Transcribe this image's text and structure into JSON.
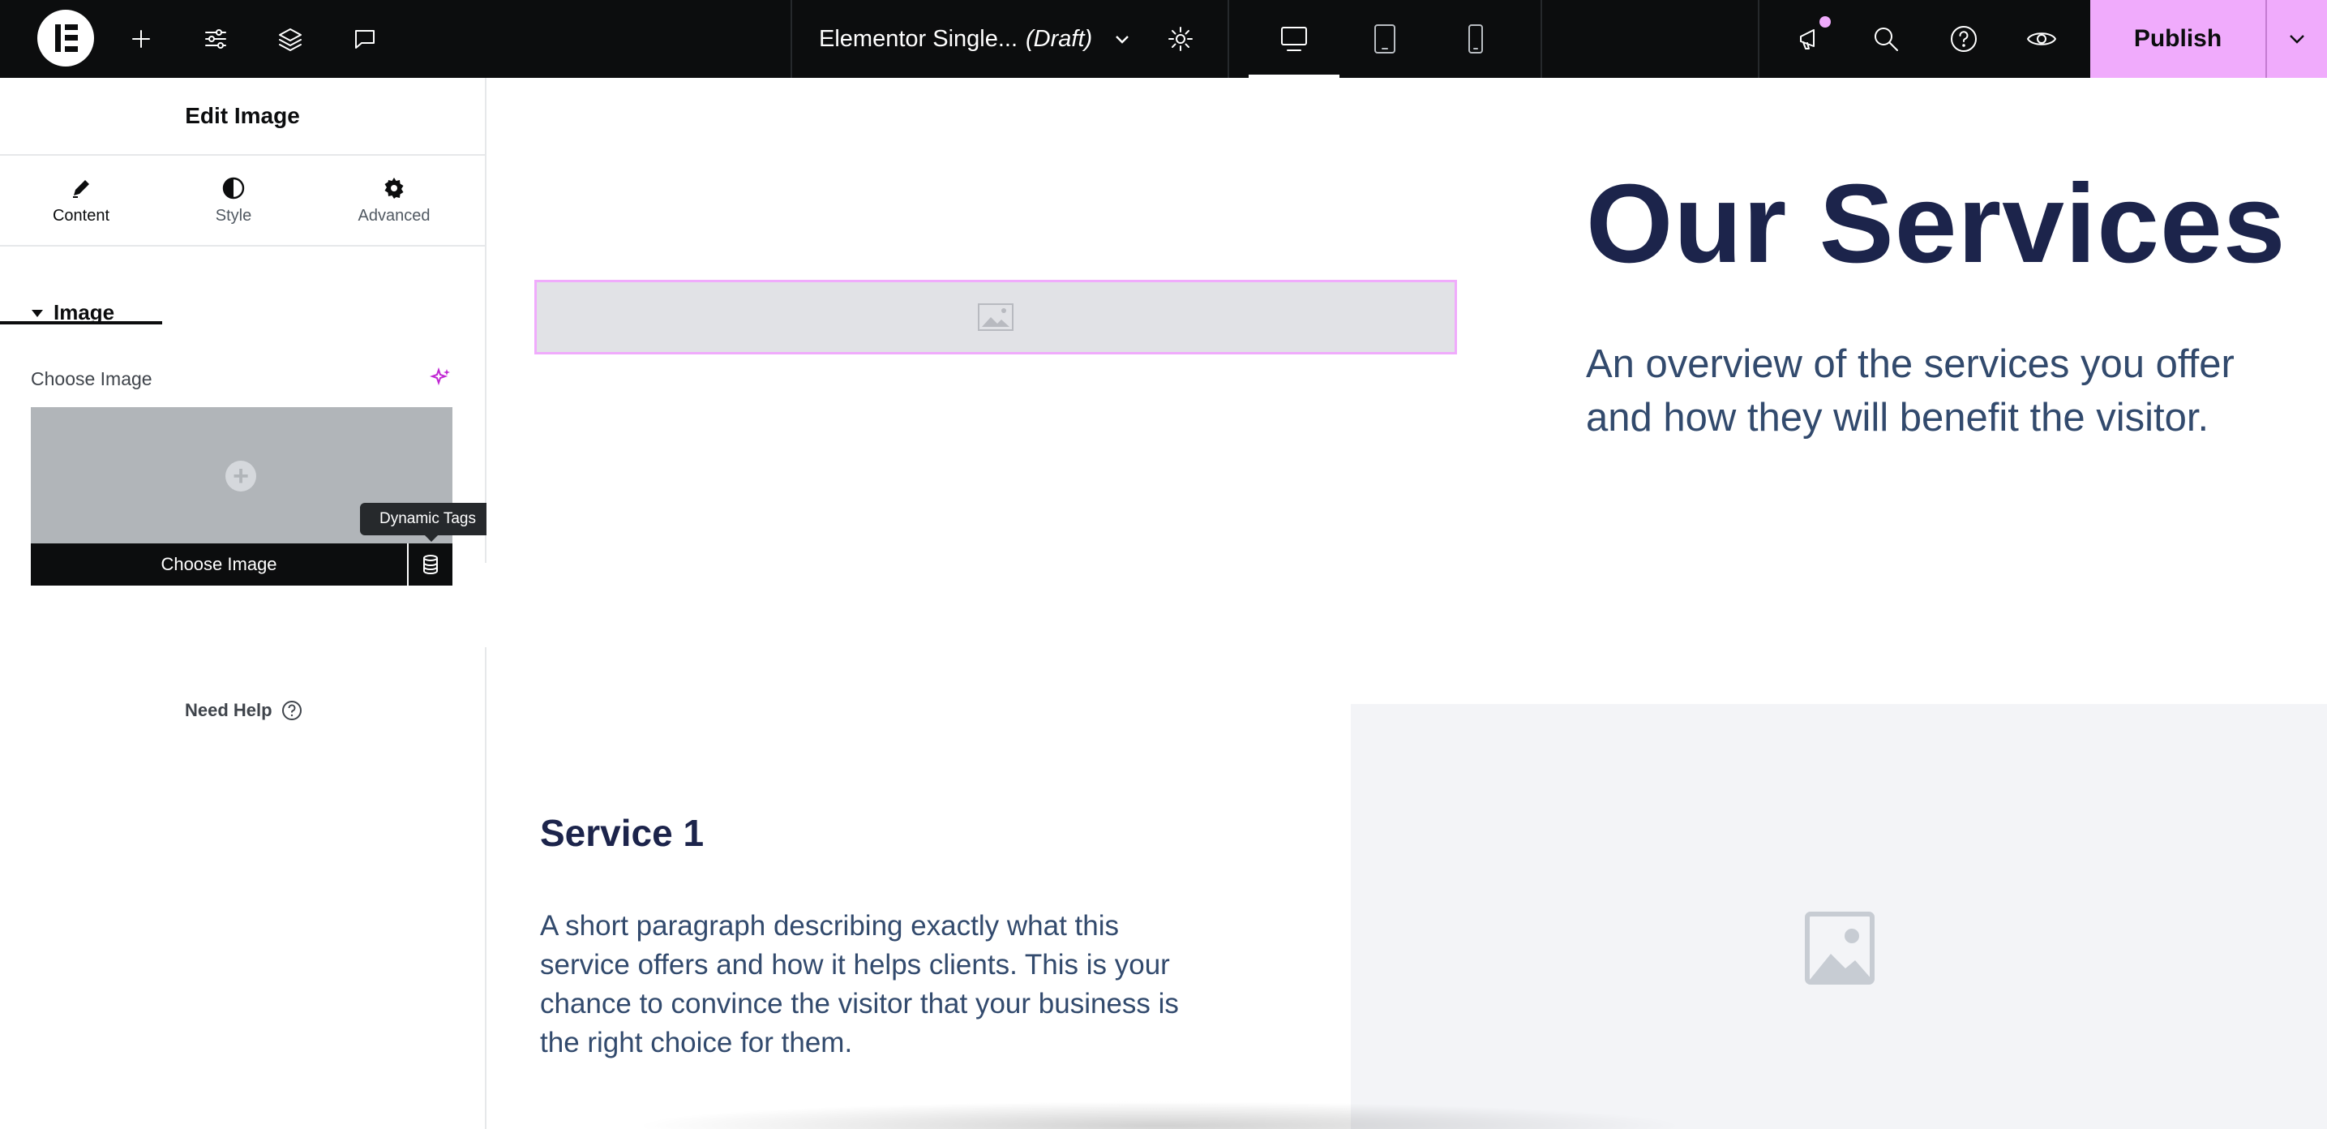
{
  "topbar": {
    "doc_title": "Elementor Single...",
    "doc_status": "(Draft)",
    "publish_label": "Publish",
    "accent_color": "#f0abfc"
  },
  "panel": {
    "title": "Edit Image",
    "tabs": [
      {
        "label": "Content",
        "icon": "pencil-icon",
        "active": true
      },
      {
        "label": "Style",
        "icon": "half-circle-icon",
        "active": false
      },
      {
        "label": "Advanced",
        "icon": "gear-icon",
        "active": false
      }
    ],
    "section_title": "Image",
    "choose_image_label": "Choose Image",
    "choose_image_button": "Choose Image",
    "dynamic_tags_tooltip": "Dynamic Tags",
    "need_help": "Need Help"
  },
  "canvas": {
    "heading": "Our Services",
    "subheading": "An overview of the services you offer and how they will benefit the visitor.",
    "service1_title": "Service 1",
    "service1_text": "A short paragraph describing exactly what this service offers and how it helps clients. This is your chance to convince the visitor that your business is the right choice for them.",
    "heading_color": "#1c244b",
    "text_color": "#324a6d"
  }
}
